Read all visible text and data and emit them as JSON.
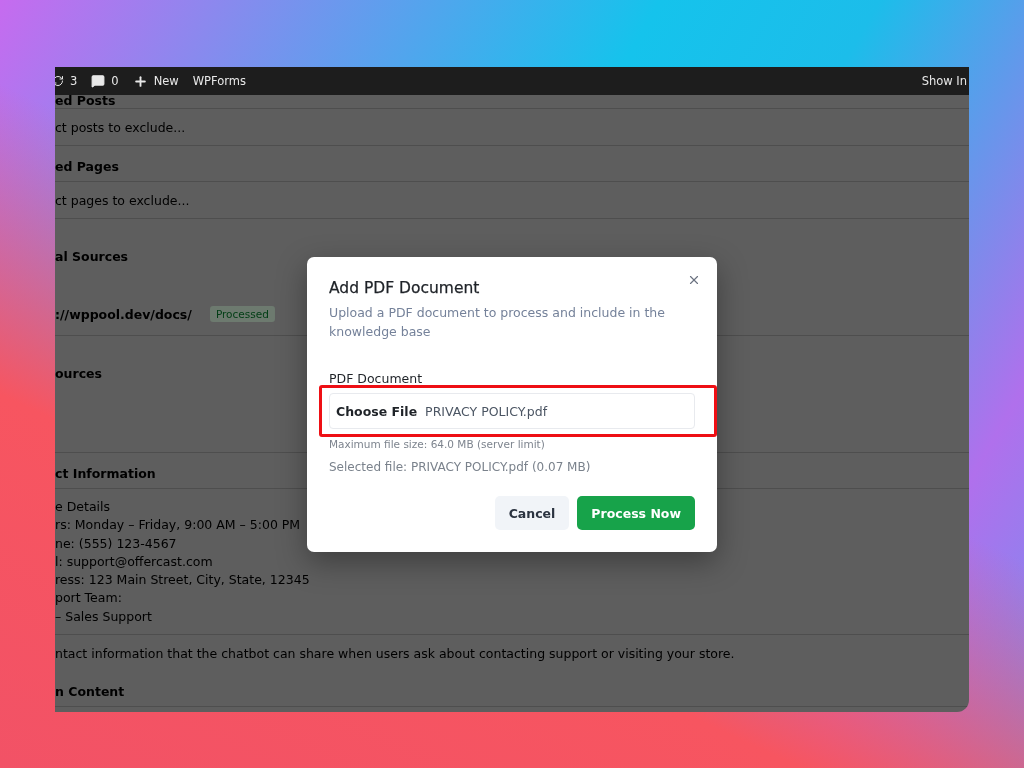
{
  "admin_bar": {
    "items": [
      {
        "kind": "updates",
        "label": "3"
      },
      {
        "kind": "comments",
        "label": "0"
      },
      {
        "kind": "new",
        "label": "New"
      },
      {
        "kind": "plain",
        "label": "WPForms"
      }
    ],
    "right_label": "Show In"
  },
  "background": {
    "rows": [
      {
        "kind": "heading",
        "text": "ed Posts"
      },
      {
        "kind": "select",
        "text": "ct posts to exclude..."
      },
      {
        "kind": "heading",
        "text": "ed Pages"
      },
      {
        "kind": "select",
        "text": "ct pages to exclude..."
      },
      {
        "kind": "sources",
        "text": "al Sources",
        "items": [
          {
            "url": "://wppool.dev/docs/",
            "badge": "Processed"
          }
        ]
      },
      {
        "kind": "sources",
        "text": "ources"
      },
      {
        "kind": "heading",
        "text": "ct Information"
      },
      {
        "kind": "textarea",
        "lines": [
          "e Details",
          "rs: Monday – Friday, 9:00 AM – 5:00 PM",
          "ne: (555) 123-4567",
          "l: support@offercast.com",
          "ress: 123 Main Street, City, State, 12345",
          "port Team:",
          "– Sales Support"
        ]
      },
      {
        "kind": "help",
        "text": "ntact information that the chatbot can share when users ask about contacting support or visiting your store."
      },
      {
        "kind": "heading",
        "text": "n Content"
      }
    ]
  },
  "dialog": {
    "title": "Add PDF Document",
    "description": "Upload a PDF document to process and include in the knowledge base",
    "field_label": "PDF Document",
    "choose_button": "Choose File",
    "file_name": "PRIVACY POLICY.pdf",
    "highlighted": true,
    "hint": "Maximum file size: 64.0 MB (server limit)",
    "selected_file": "Selected file: PRIVACY POLICY.pdf (0.07 MB)",
    "buttons": [
      {
        "kind": "secondary",
        "label": "Cancel"
      },
      {
        "kind": "primary",
        "label": "Process Now"
      }
    ]
  }
}
